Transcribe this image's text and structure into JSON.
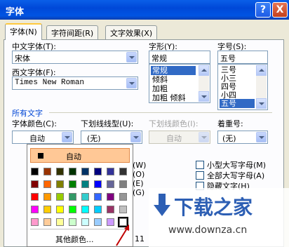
{
  "window": {
    "title": "字体",
    "help_label": "?",
    "close_label": "X"
  },
  "tabs": [
    {
      "label": "字体(N)",
      "active": true
    },
    {
      "label": "字符间距(R)",
      "active": false
    },
    {
      "label": "文字效果(X)",
      "active": false
    }
  ],
  "east_asian_font": {
    "label": "中文字体(T):",
    "value": "宋体"
  },
  "western_font": {
    "label": "西文字体(F):",
    "value": "Times New Roman"
  },
  "font_style": {
    "label": "字形(Y):",
    "value": "常规",
    "options": [
      "常规",
      "倾斜",
      "加粗",
      "加粗 倾斜"
    ],
    "selected_index": 0
  },
  "font_size": {
    "label": "字号(S):",
    "value": "五号",
    "options": [
      "三号",
      "小三",
      "四号",
      "小四",
      "五号"
    ],
    "selected_index": 4
  },
  "all_text": {
    "section_label": "所有文字",
    "font_color_label": "字体颜色(C):",
    "font_color_value": "自动",
    "underline_style_label": "下划线线型(U):",
    "underline_style_value": "(无)",
    "underline_color_label": "下划线颜色(I):",
    "underline_color_value": "自动",
    "emphasis_label": "着重号:",
    "emphasis_value": "(无)"
  },
  "effects": {
    "left_fragments": [
      "影(W)",
      "心(O)",
      "文(E)",
      "文(G)"
    ],
    "small_caps": "小型大写字母(M)",
    "all_caps": "全部大写字母(A)",
    "hidden": "隐藏文字(H)"
  },
  "color_popup": {
    "auto_label": "自动",
    "more_colors_label": "其他颜色...",
    "selected_row": 4,
    "selected_col": 7,
    "swatches": [
      [
        "#000000",
        "#993300",
        "#333300",
        "#003300",
        "#003366",
        "#000080",
        "#333399",
        "#333333"
      ],
      [
        "#800000",
        "#FF6600",
        "#808000",
        "#008000",
        "#008080",
        "#0000FF",
        "#666699",
        "#808080"
      ],
      [
        "#FF0000",
        "#FF9900",
        "#99CC00",
        "#339966",
        "#33CCCC",
        "#3366FF",
        "#800080",
        "#969696"
      ],
      [
        "#FF00FF",
        "#FFCC00",
        "#FFFF00",
        "#00FF00",
        "#00FFFF",
        "#00CCFF",
        "#993366",
        "#C0C0C0"
      ],
      [
        "#FF99CC",
        "#FFCC99",
        "#FFFF99",
        "#CCFFCC",
        "#CCFFFF",
        "#99CCFF",
        "#CC99FF",
        "#FFFFFF"
      ]
    ]
  },
  "partial_text": "11",
  "watermark": {
    "name": "下载之家",
    "url": "www.downza.cn"
  },
  "colors": {
    "titlebar": "#0054E3",
    "accent_border": "#FFC83C",
    "selection": "#316AC5",
    "hover": "#FFC896"
  }
}
